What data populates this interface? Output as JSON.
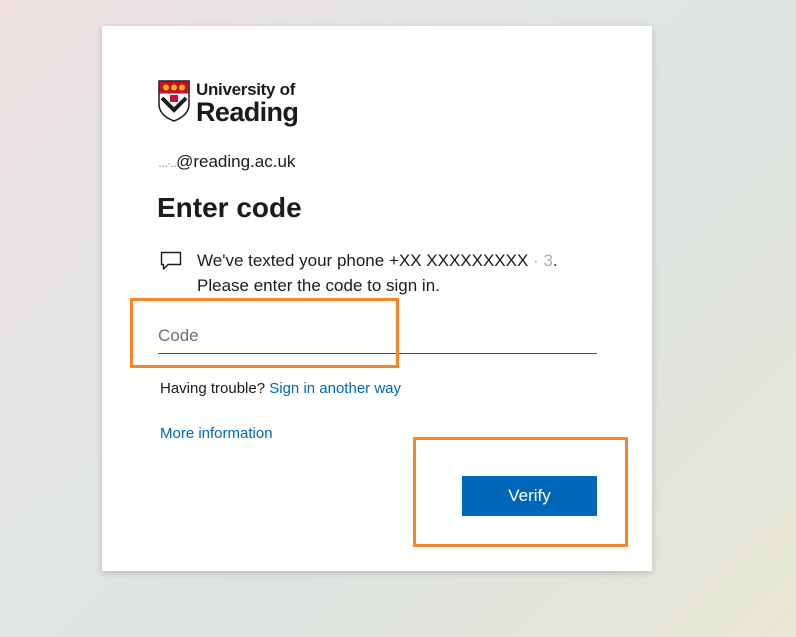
{
  "brand": {
    "line1": "University of",
    "line2": "Reading",
    "colors": {
      "shield_red": "#c8102e",
      "shield_gold": "#f2b519",
      "ink": "#1b1b1b"
    }
  },
  "identity": {
    "masked_prefix": "․․․·․․",
    "domain": "@reading.ac.uk"
  },
  "title": "Enter code",
  "message": {
    "icon": "message-icon",
    "text_before": "We've texted your phone +XX XXXXXXXXX",
    "masked_digits": "· 3",
    "text_after": ". Please enter the code to sign in."
  },
  "code_input": {
    "placeholder": "Code",
    "value": ""
  },
  "help": {
    "trouble_label": "Having trouble?",
    "alt_link": "Sign in another way",
    "more_info": "More information"
  },
  "actions": {
    "verify_label": "Verify"
  },
  "colors": {
    "accent": "#0067b8",
    "highlight": "#f5862c"
  }
}
